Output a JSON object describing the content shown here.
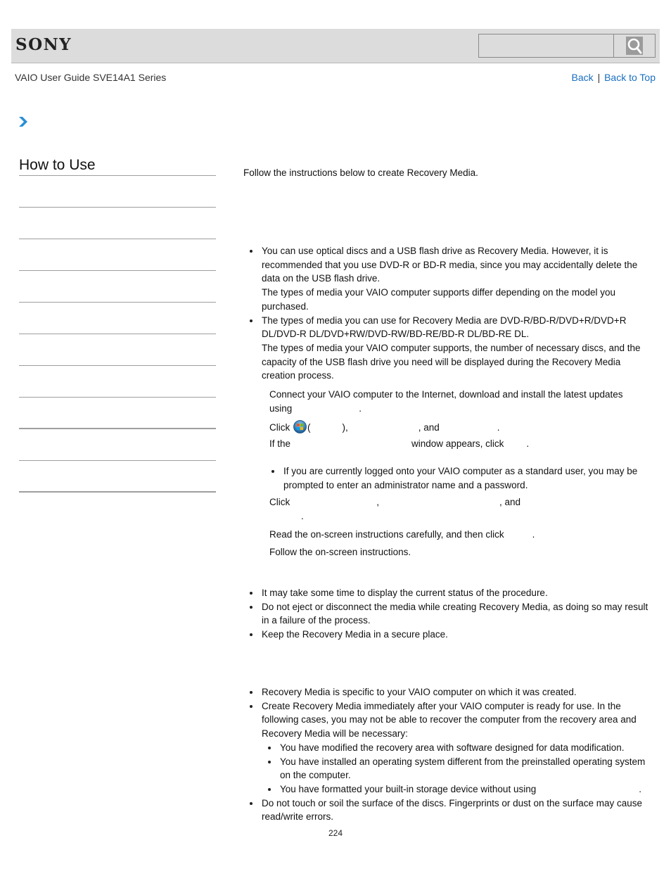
{
  "header": {
    "brand": "SONY",
    "search": {
      "placeholder": "",
      "value": "",
      "button_icon": "search-icon"
    }
  },
  "subheader": {
    "guide_title": "VAIO User Guide SVE14A1 Series",
    "links": {
      "back": "Back",
      "separator": "|",
      "back_to_top": "Back to Top"
    }
  },
  "breadcrumb": {
    "icon": "chevron-right-icon"
  },
  "sidebar": {
    "title": "How to Use",
    "items": [
      "",
      "",
      "",
      "",
      "",
      "",
      "",
      "",
      "",
      ""
    ]
  },
  "main": {
    "intro": "Follow the instructions below to create Recovery Media.",
    "hints": [
      {
        "text": "You can use optical discs and a USB flash drive as Recovery Media. However, it is recommended that you use DVD-R or BD-R media, since you may accidentally delete the data on the USB flash drive.",
        "sub": "The types of media your VAIO computer supports differ depending on the model you purchased."
      },
      {
        "text": "The types of media you can use for Recovery Media are DVD-R/BD-R/DVD+R/DVD+R DL/DVD-R DL/DVD+RW/DVD-RW/BD-RE/BD-R DL/BD-RE DL.",
        "sub": "The types of media your VAIO computer supports, the number of necessary discs, and the capacity of the USB flash drive you need will be displayed during the Recovery Media creation process."
      }
    ],
    "steps": {
      "step1_line1": "Connect your VAIO computer to the Internet, download and install the latest updates",
      "step1_line2_a": "using",
      "step1_line2_b": ".",
      "step2_click": "Click",
      "step2_paren_open": "(",
      "step2_paren_close": "),",
      "step2_and": ", and",
      "step2_end": ".",
      "step2_if": "If the",
      "step2_window": "window appears, click",
      "step2_end2": ".",
      "step2_note": "If you are currently logged onto your VAIO computer as a standard user, you may be prompted to enter an administrator name and a password.",
      "step3_click": "Click",
      "step3_comma": ",",
      "step3_and": ", and",
      "step3_end": ".",
      "step4": "Read the on-screen instructions carefully, and then click",
      "step4_end": ".",
      "step5": "Follow the on-screen instructions."
    },
    "notes": [
      "It may take some time to display the current status of the procedure.",
      "Do not eject or disconnect the media while creating Recovery Media, as doing so may result in a failure of the process.",
      "Keep the Recovery Media in a secure place."
    ],
    "notes2": {
      "item1": "Recovery Media is specific to your VAIO computer on which it was created.",
      "item2": "Create Recovery Media immediately after your VAIO computer is ready for use. In the following cases, you may not be able to recover the computer from the recovery area and Recovery Media will be necessary:",
      "sub_items": [
        "You have modified the recovery area with software designed for data modification.",
        "You have installed an operating system different from the preinstalled operating system on the computer.",
        "You have formatted your built-in storage device without using"
      ],
      "sub3_end": ".",
      "item3": "Do not touch or soil the surface of the discs. Fingerprints or dust on the surface may cause read/write errors."
    }
  },
  "footer": {
    "page_number": "224"
  }
}
